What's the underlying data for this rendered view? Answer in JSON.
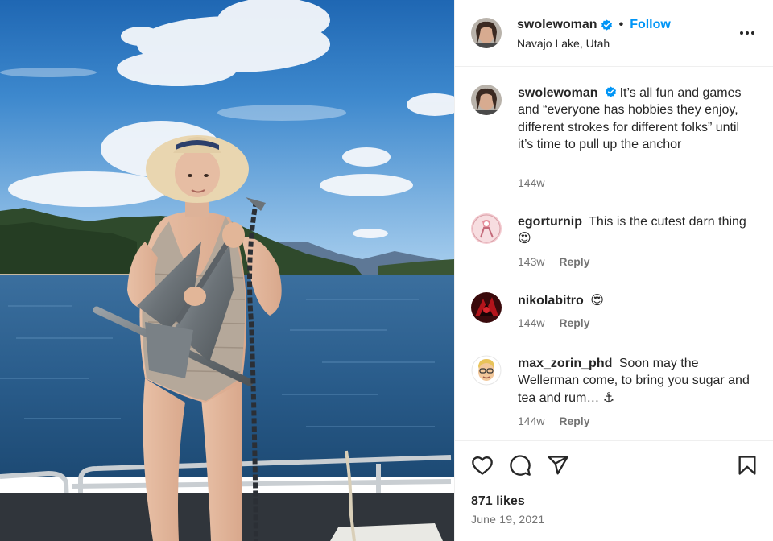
{
  "post": {
    "author": "swolewoman",
    "follow_label": "Follow",
    "separator": "•",
    "location": "Navajo Lake, Utah",
    "more_label": "More options"
  },
  "comments": [
    {
      "username": "swolewoman",
      "text": "It’s all fun and games and “everyone has hobbies they enjoy, different strokes for different folks” until it’s time to pull up the anchor",
      "time": "144w",
      "verified": true,
      "avatar": "woman-portrait"
    },
    {
      "username": "egorturnip",
      "text": "This is the cutest darn thing 😍",
      "time": "143w",
      "reply_label": "Reply",
      "avatar": "pink-illustration"
    },
    {
      "username": "nikolabitro",
      "text": "😍",
      "time": "144w",
      "reply_label": "Reply",
      "avatar": "red-black-pattern"
    },
    {
      "username": "max_zorin_phd",
      "text": "Soon may the Wellerman come, to bring you sugar and tea and rum… ⚓",
      "time": "144w",
      "reply_label": "Reply",
      "avatar": "memoji"
    }
  ],
  "engagement": {
    "likes": "871 likes",
    "date": "June 19, 2021"
  },
  "icons": [
    "heart-icon",
    "comment-icon",
    "share-icon",
    "bookmark-icon",
    "verified-icon",
    "more-icon"
  ],
  "colors": {
    "accent": "#0095f6",
    "text": "#262626",
    "secondary": "#737373",
    "border": "#efefef"
  }
}
